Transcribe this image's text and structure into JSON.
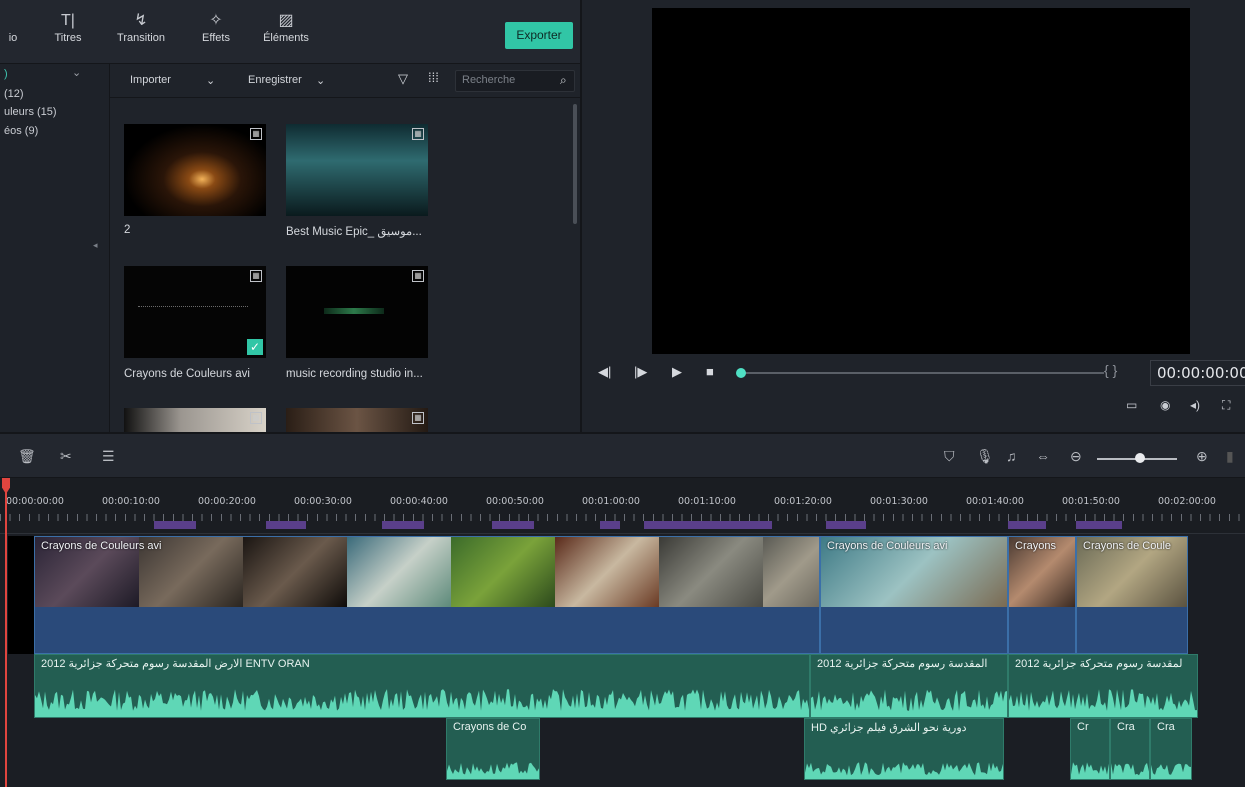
{
  "toolbar": {
    "tabs": [
      {
        "label": "io",
        "icon": "audio-icon"
      },
      {
        "label": "Titres",
        "icon": "titles-icon"
      },
      {
        "label": "Transition",
        "icon": "transition-icon"
      },
      {
        "label": "Effets",
        "icon": "effects-icon"
      },
      {
        "label": "Éléments",
        "icon": "elements-icon"
      }
    ],
    "export_label": "Exporter",
    "export_color": "#31c6a6"
  },
  "library": {
    "items": [
      {
        "label": ")"
      },
      {
        "label": "(12)"
      },
      {
        "label": "uleurs (15)"
      },
      {
        "label": "éos (9)"
      }
    ]
  },
  "media_toolbar": {
    "import_label": "Importer",
    "record_label": "Enregistrer",
    "search_placeholder": "Recherche"
  },
  "media_items": [
    {
      "caption": "2"
    },
    {
      "caption": "Best Music Epic_ موسيق..."
    },
    {
      "caption": "Crayons de Couleurs avi",
      "checked": true
    },
    {
      "caption": "music recording studio in..."
    }
  ],
  "preview": {
    "timecode": "00:00:00:00",
    "brackets": "{ }"
  },
  "ruler": {
    "ticks": [
      "00:00:00:00",
      "00:00:10:00",
      "00:00:20:00",
      "00:00:30:00",
      "00:00:40:00",
      "00:00:50:00",
      "00:01:00:00",
      "00:01:10:00",
      "00:01:20:00",
      "00:01:30:00",
      "00:01:40:00",
      "00:01:50:00",
      "00:02:00:00"
    ]
  },
  "video_track": {
    "clips": [
      {
        "label": "Crayons de Couleurs avi"
      },
      {
        "label": "Crayons de Couleurs avi"
      },
      {
        "label": "Crayons"
      },
      {
        "label": "Crayons de Coule"
      }
    ]
  },
  "audio_track": {
    "clips": [
      {
        "label": "2012 الارض المقدسة رسوم متحركة جزائرية ENTV ORAN"
      },
      {
        "label": "2012 المقدسة رسوم متحركة جزائرية"
      },
      {
        "label": "2012 لمقدسة رسوم متحركة جزائرية"
      }
    ]
  },
  "audio_track2": {
    "clips": [
      {
        "label": "Crayons de Co"
      },
      {
        "label": "HD دورية نحو الشرق فيلم جزائري"
      },
      {
        "label": "Cr"
      },
      {
        "label": "Cra"
      },
      {
        "label": "Cra"
      }
    ]
  }
}
